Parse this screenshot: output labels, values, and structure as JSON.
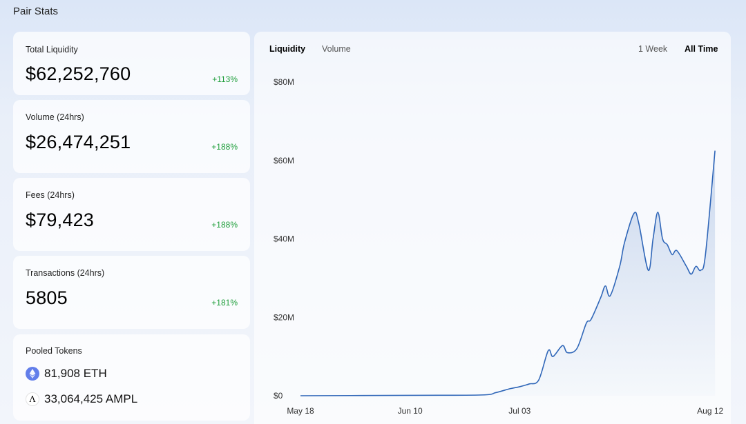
{
  "page": {
    "title": "Pair Stats"
  },
  "stats": [
    {
      "label": "Total Liquidity",
      "value": "$62,252,760",
      "change": "+113%"
    },
    {
      "label": "Volume (24hrs)",
      "value": "$26,474,251",
      "change": "+188%"
    },
    {
      "label": "Fees (24hrs)",
      "value": "$79,423",
      "change": "+188%"
    },
    {
      "label": "Transactions (24hrs)",
      "value": "5805",
      "change": "+181%"
    }
  ],
  "pooled": {
    "label": "Pooled Tokens",
    "tokens": [
      {
        "text": "81,908 ETH",
        "icon": "eth-icon"
      },
      {
        "text": "33,064,425 AMPL",
        "icon": "ampl-icon",
        "glyph": "Λ"
      }
    ]
  },
  "chart_tabs": {
    "liquidity": "Liquidity",
    "volume": "Volume",
    "week": "1 Week",
    "all": "All Time"
  },
  "colors": {
    "line": "#2f66b8",
    "positive": "#1e9e3a",
    "eth": "#627eea"
  },
  "chart_data": {
    "type": "area",
    "title": "",
    "xlabel": "",
    "ylabel": "",
    "ylim": [
      0,
      80000000
    ],
    "y_ticks": [
      {
        "value": 0,
        "label": "$0"
      },
      {
        "value": 20000000,
        "label": "$20M"
      },
      {
        "value": 40000000,
        "label": "$40M"
      },
      {
        "value": 60000000,
        "label": "$60M"
      },
      {
        "value": 80000000,
        "label": "$80M"
      }
    ],
    "x_range": [
      "2020-05-18",
      "2020-08-14"
    ],
    "x_ticks": [
      {
        "date": "2020-05-18",
        "label": "May 18"
      },
      {
        "date": "2020-06-10",
        "label": "Jun 10"
      },
      {
        "date": "2020-07-03",
        "label": "Jul 03"
      },
      {
        "date": "2020-08-12",
        "label": "Aug 12"
      }
    ],
    "grid": false,
    "series": [
      {
        "points": [
          [
            "2020-05-18",
            0
          ],
          [
            "2020-06-10",
            100000
          ],
          [
            "2020-06-25",
            200000
          ],
          [
            "2020-06-28",
            800000
          ],
          [
            "2020-07-01",
            1800000
          ],
          [
            "2020-07-03",
            2300000
          ],
          [
            "2020-07-05",
            3000000
          ],
          [
            "2020-07-07",
            4000000
          ],
          [
            "2020-07-09",
            11500000
          ],
          [
            "2020-07-10",
            10000000
          ],
          [
            "2020-07-12",
            12800000
          ],
          [
            "2020-07-13",
            11000000
          ],
          [
            "2020-07-15",
            12000000
          ],
          [
            "2020-07-17",
            18500000
          ],
          [
            "2020-07-18",
            19500000
          ],
          [
            "2020-07-20",
            25000000
          ],
          [
            "2020-07-21",
            28000000
          ],
          [
            "2020-07-22",
            25500000
          ],
          [
            "2020-07-24",
            33000000
          ],
          [
            "2020-07-25",
            39000000
          ],
          [
            "2020-07-27",
            46500000
          ],
          [
            "2020-07-28",
            44000000
          ],
          [
            "2020-07-30",
            32000000
          ],
          [
            "2020-07-31",
            40000000
          ],
          [
            "2020-08-01",
            46800000
          ],
          [
            "2020-08-02",
            40000000
          ],
          [
            "2020-08-03",
            38500000
          ],
          [
            "2020-08-04",
            36000000
          ],
          [
            "2020-08-05",
            37000000
          ],
          [
            "2020-08-07",
            33000000
          ],
          [
            "2020-08-08",
            31000000
          ],
          [
            "2020-08-09",
            33000000
          ],
          [
            "2020-08-10",
            32000000
          ],
          [
            "2020-08-11",
            36000000
          ],
          [
            "2020-08-13",
            62500000
          ]
        ]
      }
    ]
  }
}
